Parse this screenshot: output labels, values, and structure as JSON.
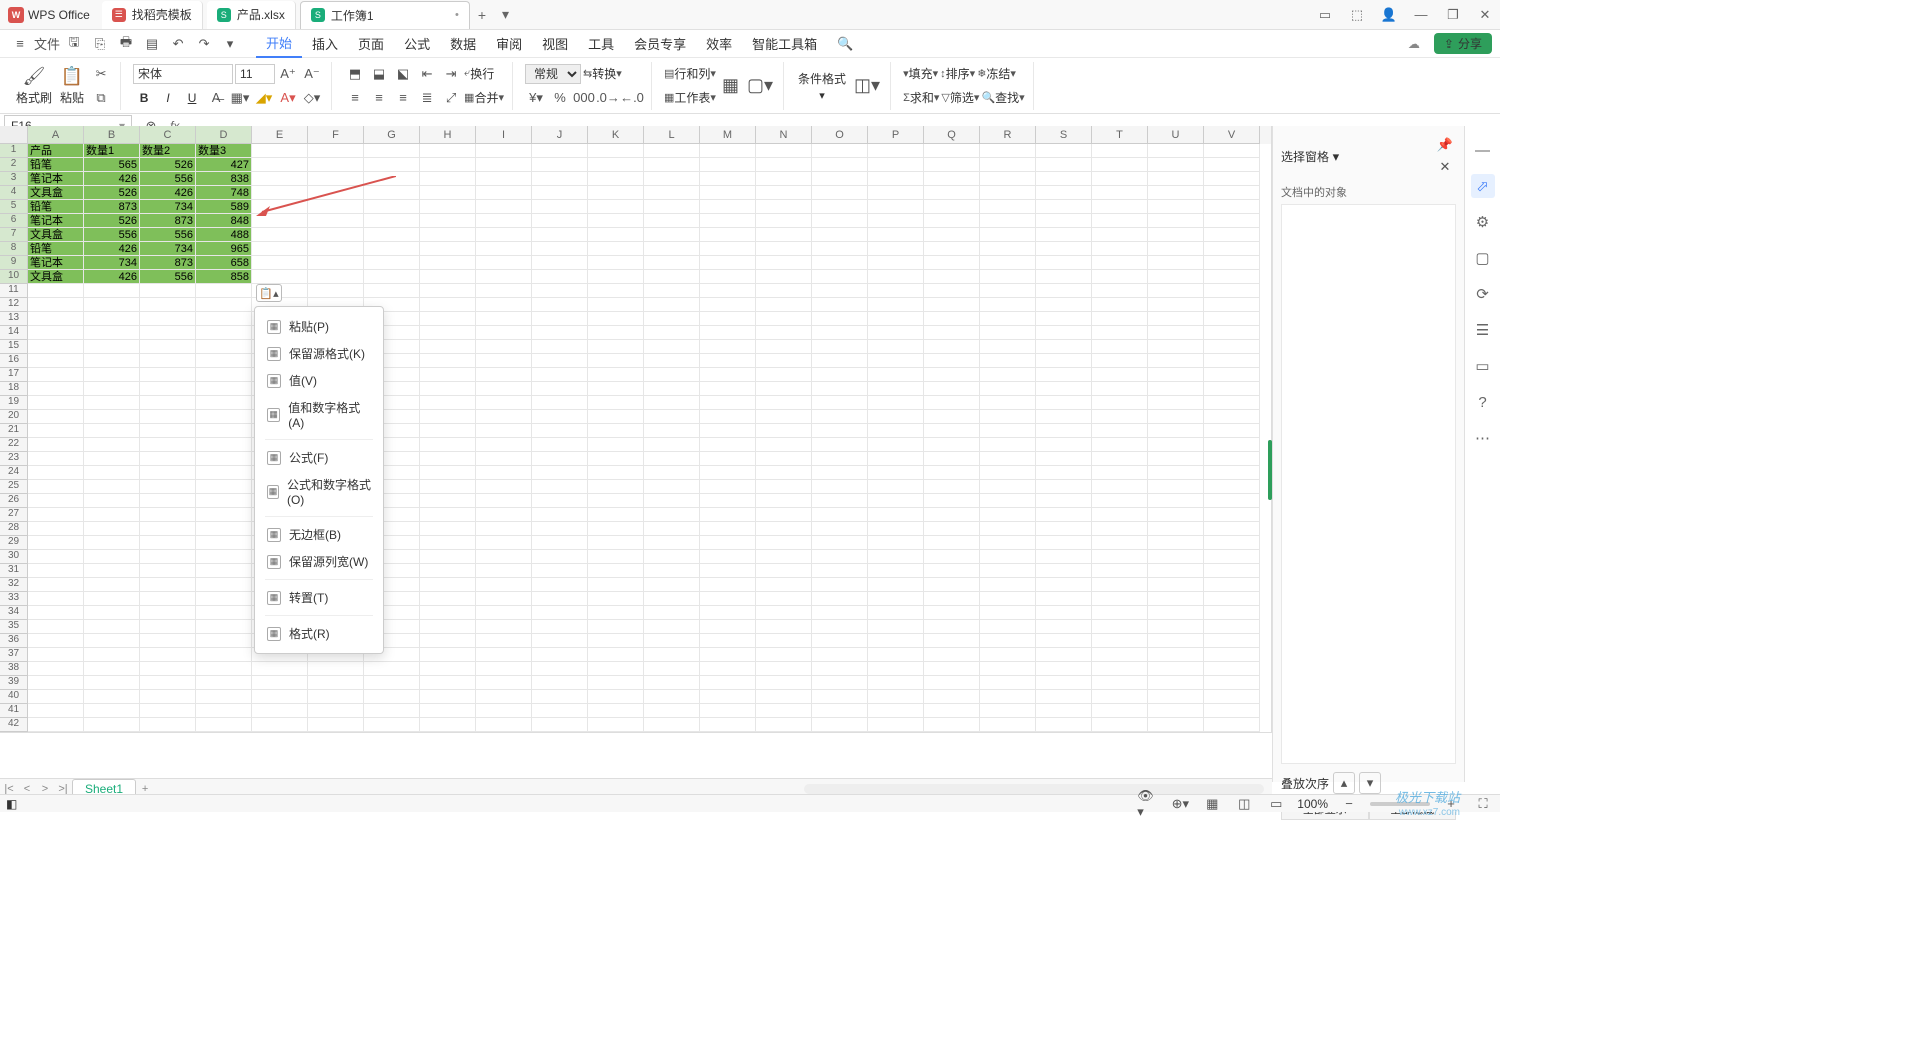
{
  "app": {
    "name": "WPS Office"
  },
  "tabs": {
    "template": "找稻壳模板",
    "file1": "产品.xlsx",
    "file2": "工作簿1",
    "add": "+"
  },
  "menu": {
    "file": "文件",
    "items": [
      "开始",
      "插入",
      "页面",
      "公式",
      "数据",
      "审阅",
      "视图",
      "工具",
      "会员专享",
      "效率",
      "智能工具箱"
    ]
  },
  "share": "分享",
  "ribbon": {
    "format_painter": "格式刷",
    "paste": "粘贴",
    "font": "宋体",
    "size": "11",
    "wrap": "换行",
    "merge": "合并",
    "general": "常规",
    "convert": "转换",
    "row_col": "行和列",
    "worksheet": "工作表",
    "cond_fmt": "条件格式",
    "fill": "填充",
    "sort": "排序",
    "freeze": "冻结",
    "sum": "求和",
    "filter": "筛选",
    "find": "查找"
  },
  "namebox": "F16",
  "rightpane": {
    "title": "选择窗格",
    "objects": "文档中的对象",
    "order": "叠放次序",
    "show_all": "全部显示",
    "hide_all": "全部隐藏"
  },
  "columns": [
    "A",
    "B",
    "C",
    "D",
    "E",
    "F",
    "G",
    "H",
    "I",
    "J",
    "K",
    "L",
    "M",
    "N",
    "O",
    "P",
    "Q",
    "R",
    "S",
    "T",
    "U",
    "V"
  ],
  "rowcount": 42,
  "table": {
    "headers": [
      "产品",
      "数量1",
      "数量2",
      "数量3"
    ],
    "rows": [
      [
        "铅笔",
        "565",
        "526",
        "427"
      ],
      [
        "笔记本",
        "426",
        "556",
        "838"
      ],
      [
        "文具盒",
        "526",
        "426",
        "748"
      ],
      [
        "铅笔",
        "873",
        "734",
        "589"
      ],
      [
        "笔记本",
        "526",
        "873",
        "848"
      ],
      [
        "文具盒",
        "556",
        "556",
        "488"
      ],
      [
        "铅笔",
        "426",
        "734",
        "965"
      ],
      [
        "笔记本",
        "734",
        "873",
        "658"
      ],
      [
        "文具盒",
        "426",
        "556",
        "858"
      ]
    ]
  },
  "ctxmenu": [
    "粘贴(P)",
    "保留源格式(K)",
    "值(V)",
    "值和数字格式(A)",
    "",
    "公式(F)",
    "公式和数字格式(O)",
    "",
    "无边框(B)",
    "保留源列宽(W)",
    "",
    "转置(T)",
    "",
    "格式(R)"
  ],
  "sheet": {
    "name": "Sheet1"
  },
  "status": {
    "zoom": "100%"
  },
  "watermark": "极光下载站",
  "watermark2": "www.xz7.com"
}
